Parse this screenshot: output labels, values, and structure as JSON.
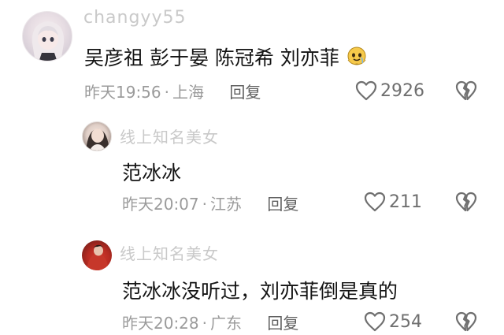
{
  "comments": [
    {
      "username": "changyy55",
      "text": "吴彦祖 彭于晏 陈冠希 刘亦菲",
      "emoji": "melting-face-emoji",
      "time": "昨天19:56",
      "location": "上海",
      "reply": "回复",
      "likes": "2926"
    },
    {
      "username": "线上知名美女",
      "text": "范冰冰",
      "time": "昨天20:07",
      "location": "江苏",
      "reply": "回复",
      "likes": "211"
    },
    {
      "username": "线上知名美女",
      "text": "范冰冰没听过，刘亦菲倒是真的",
      "time": "昨天20:28",
      "location": "广东",
      "reply": "回复",
      "likes": "254"
    }
  ],
  "separator": "·",
  "colors": {
    "text": "#141414",
    "meta": "#9b9b9b",
    "username": "#c9c9c9",
    "icon": "#6f6f6f"
  },
  "icons": [
    "heart-outline-icon",
    "broken-heart-icon"
  ]
}
